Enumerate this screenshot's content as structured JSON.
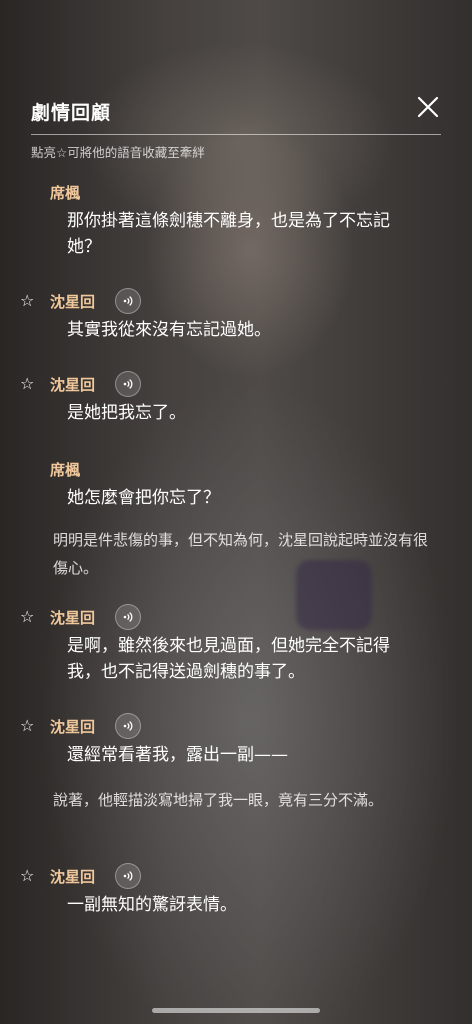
{
  "header": {
    "title": "劇情回顧",
    "subtitle": "點亮☆可將他的語音收藏至牽絆"
  },
  "entries": [
    {
      "speaker": "席楓",
      "text": "那你掛著這條劍穗不離身，也是為了不忘記她？",
      "has_star": false,
      "has_voice": false
    },
    {
      "speaker": "沈星回",
      "text": "其實我從來沒有忘記過她。",
      "has_star": true,
      "has_voice": true
    },
    {
      "speaker": "沈星回",
      "text": "是她把我忘了。",
      "has_star": true,
      "has_voice": true
    },
    {
      "speaker": "席楓",
      "text": "她怎麼會把你忘了？",
      "has_star": false,
      "has_voice": false
    },
    {
      "narration": "明明是件悲傷的事，但不知為何，沈星回說起時並沒有很傷心。"
    },
    {
      "speaker": "沈星回",
      "text": "是啊，雖然後來也見過面，但她完全不記得我，也不記得送過劍穗的事了。",
      "has_star": true,
      "has_voice": true
    },
    {
      "speaker": "沈星回",
      "text": "還經常看著我，露出一副——",
      "has_star": true,
      "has_voice": true
    },
    {
      "narration": "說著，他輕描淡寫地掃了我一眼，竟有三分不滿。"
    },
    {
      "speaker": "沈星回",
      "text": "一副無知的驚訝表情。",
      "has_star": true,
      "has_voice": true
    }
  ],
  "icons": {
    "star": "star-outline-icon",
    "voice": "voice-play-icon",
    "close": "close-icon"
  },
  "colors": {
    "speaker": "#f0c89c",
    "text": "#ffffff"
  }
}
